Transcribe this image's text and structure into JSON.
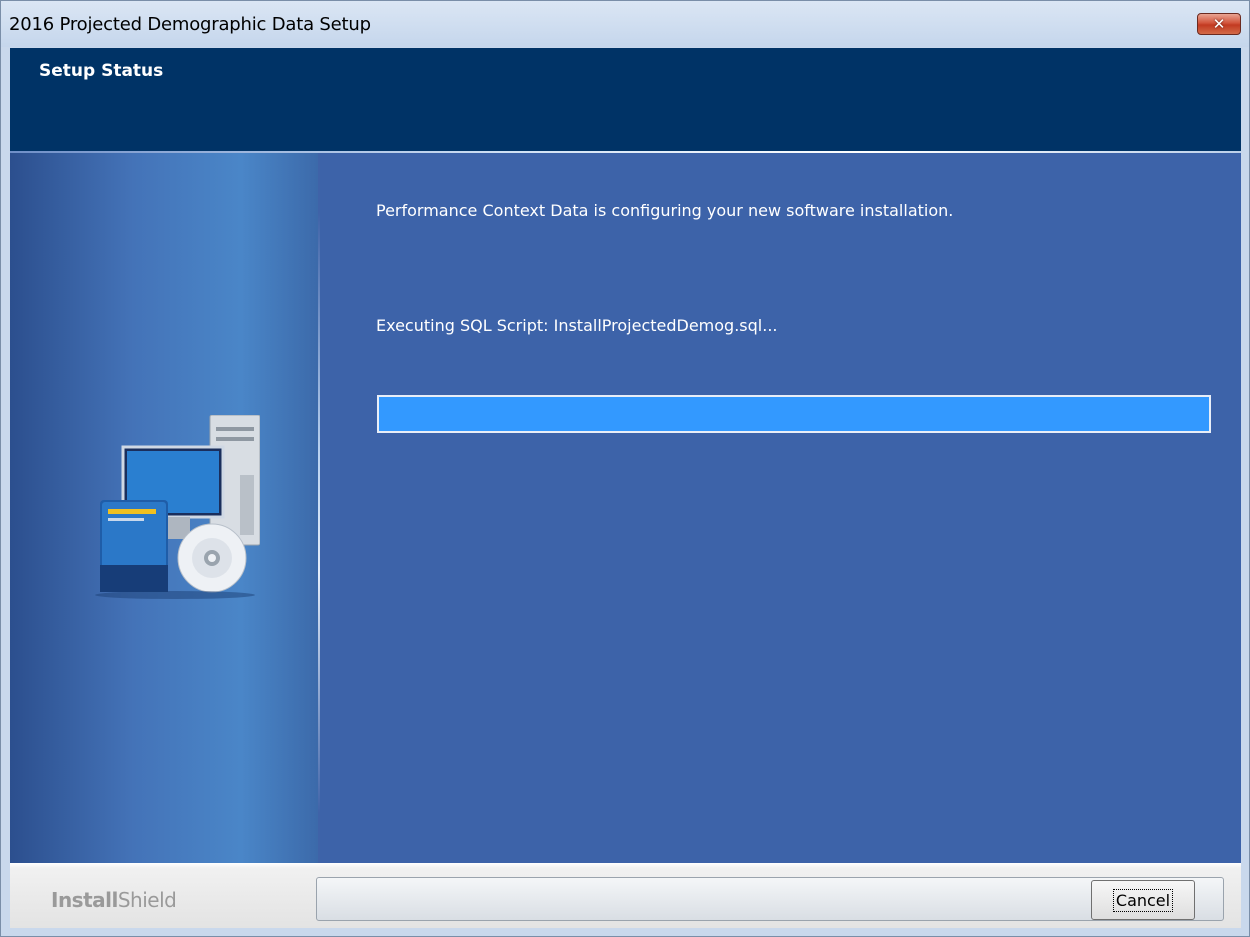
{
  "window": {
    "title": "2016 Projected Demographic Data Setup",
    "close_icon": "close-icon"
  },
  "header": {
    "title": "Setup Status"
  },
  "main": {
    "message": "Performance Context Data is configuring your new software installation.",
    "status": "Executing SQL Script: InstallProjectedDemog.sql...",
    "progress": 1.0
  },
  "footer": {
    "brand_bold": "Install",
    "brand_light": "Shield",
    "cancel_label": "Cancel"
  },
  "colors": {
    "header_bg": "#003366",
    "panel_bg": "#3d63a9",
    "progress_fill": "#3399ff"
  }
}
